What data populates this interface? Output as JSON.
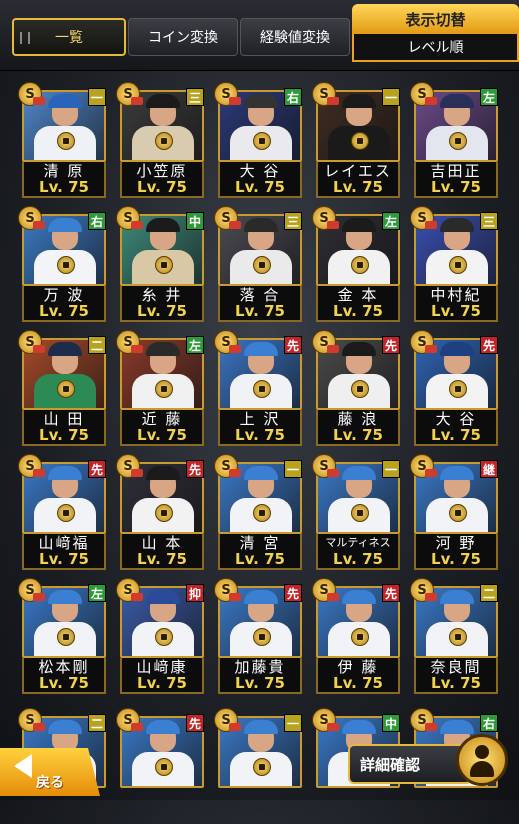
{
  "tabs": [
    {
      "label": "一覧",
      "active": true
    },
    {
      "label": "コイン変換",
      "active": false
    },
    {
      "label": "経験値変換",
      "active": false
    }
  ],
  "display_switch": {
    "title": "表示切替",
    "sort": "レベル順"
  },
  "level_prefix": "Lv.",
  "cards": [
    {
      "name": "清 原",
      "level": "75",
      "position": "一",
      "pos_color": "#b8a21e",
      "bg": "#4f86c9",
      "cap": "#2a63b8",
      "uniform": "#eef2f6"
    },
    {
      "name": "小笠原",
      "level": "75",
      "position": "三",
      "pos_color": "#b8a21e",
      "bg": "#3b3b3b",
      "cap": "#1b1b1b",
      "uniform": "#d9cbb0"
    },
    {
      "name": "大 谷",
      "level": "75",
      "position": "右",
      "pos_color": "#2f9a3a",
      "bg": "#2b3a7a",
      "cap": "#333",
      "uniform": "#e9e9ee"
    },
    {
      "name": "レイエス",
      "level": "75",
      "position": "一",
      "pos_color": "#b8a21e",
      "bg": "#3f2c22",
      "cap": "#1b1b1b",
      "uniform": "#1a1a1a"
    },
    {
      "name": "吉田正",
      "level": "75",
      "position": "左",
      "pos_color": "#2f9a3a",
      "bg": "#6b4a8a",
      "cap": "#2a2f5a",
      "uniform": "#e3e6ee"
    },
    {
      "name": "万 波",
      "level": "75",
      "position": "右",
      "pos_color": "#2f9a3a",
      "bg": "#3c7ac3",
      "cap": "#3a7fd1",
      "uniform": "#f2f4f7"
    },
    {
      "name": "糸 井",
      "level": "75",
      "position": "中",
      "pos_color": "#2f9a3a",
      "bg": "#3e8a7a",
      "cap": "#1b1b1b",
      "uniform": "#d9c8a6"
    },
    {
      "name": "落 合",
      "level": "75",
      "position": "三",
      "pos_color": "#b8a21e",
      "bg": "#4a4a52",
      "cap": "#2a2a2a",
      "uniform": "#eaeaea"
    },
    {
      "name": "金 本",
      "level": "75",
      "position": "左",
      "pos_color": "#2f9a3a",
      "bg": "#2e2e34",
      "cap": "#1b1b1b",
      "uniform": "#f1f1f1"
    },
    {
      "name": "中村紀",
      "level": "75",
      "position": "三",
      "pos_color": "#b8a21e",
      "bg": "#3a4fb0",
      "cap": "#2a2a2a",
      "uniform": "#f3f3f3"
    },
    {
      "name": "山 田",
      "level": "75",
      "position": "二",
      "pos_color": "#b8a21e",
      "bg": "#a54a2a",
      "cap": "#1b2d4a",
      "uniform": "#2c8a55"
    },
    {
      "name": "近 藤",
      "level": "75",
      "position": "左",
      "pos_color": "#2f9a3a",
      "bg": "#8a3a2a",
      "cap": "#2a2a2a",
      "uniform": "#f0f0f0"
    },
    {
      "name": "上 沢",
      "level": "75",
      "position": "先",
      "pos_color": "#c2242a",
      "bg": "#3b74c4",
      "cap": "#3a7fd1",
      "uniform": "#f0f2f6"
    },
    {
      "name": "藤 浪",
      "level": "75",
      "position": "先",
      "pos_color": "#c2242a",
      "bg": "#4a4a4a",
      "cap": "#1b1b1b",
      "uniform": "#efefef"
    },
    {
      "name": "大 谷",
      "level": "75",
      "position": "先",
      "pos_color": "#c2242a",
      "bg": "#2f64b4",
      "cap": "#1e3f80",
      "uniform": "#f3f3f3"
    },
    {
      "name": "山﨑福",
      "level": "75",
      "position": "先",
      "pos_color": "#c2242a",
      "bg": "#3a78c6",
      "cap": "#3a7fd1",
      "uniform": "#f1f3f7"
    },
    {
      "name": "山 本",
      "level": "75",
      "position": "先",
      "pos_color": "#c2242a",
      "bg": "#2f2f3a",
      "cap": "#1b1b1b",
      "uniform": "#f2f2f2"
    },
    {
      "name": "清 宮",
      "level": "75",
      "position": "一",
      "pos_color": "#b8a21e",
      "bg": "#3a78c6",
      "cap": "#3a7fd1",
      "uniform": "#f1f3f7"
    },
    {
      "name": "マルティネス",
      "level": "75",
      "position": "一",
      "pos_color": "#b8a21e",
      "bg": "#3a78c6",
      "cap": "#3a7fd1",
      "uniform": "#f1f3f7"
    },
    {
      "name": "河 野",
      "level": "75",
      "position": "継",
      "pos_color": "#c2242a",
      "bg": "#3a78c6",
      "cap": "#3a7fd1",
      "uniform": "#f1f3f7"
    },
    {
      "name": "松本剛",
      "level": "75",
      "position": "左",
      "pos_color": "#2f9a3a",
      "bg": "#3a78c6",
      "cap": "#3a7fd1",
      "uniform": "#f1f3f7"
    },
    {
      "name": "山﨑康",
      "level": "75",
      "position": "抑",
      "pos_color": "#c2242a",
      "bg": "#3b5aa8",
      "cap": "#2a4a9a",
      "uniform": "#f1f3f7"
    },
    {
      "name": "加藤貴",
      "level": "75",
      "position": "先",
      "pos_color": "#c2242a",
      "bg": "#3a78c6",
      "cap": "#3a7fd1",
      "uniform": "#f1f3f7"
    },
    {
      "name": "伊 藤",
      "level": "75",
      "position": "先",
      "pos_color": "#c2242a",
      "bg": "#3a78c6",
      "cap": "#3a7fd1",
      "uniform": "#f1f3f7"
    },
    {
      "name": "奈良間",
      "level": "75",
      "position": "二",
      "pos_color": "#b8a21e",
      "bg": "#3a78c6",
      "cap": "#3a7fd1",
      "uniform": "#f1f3f7"
    }
  ],
  "partial_row": [
    {
      "position": "二",
      "pos_color": "#b8a21e",
      "bg": "#3a78c6",
      "cap": "#3a7fd1",
      "uniform": "#f1f3f7"
    },
    {
      "position": "先",
      "pos_color": "#c2242a",
      "bg": "#3a78c6",
      "cap": "#3a7fd1",
      "uniform": "#f1f3f7"
    },
    {
      "position": "一",
      "pos_color": "#b8a21e",
      "bg": "#3a78c6",
      "cap": "#3a7fd1",
      "uniform": "#f1f3f7"
    },
    {
      "position": "中",
      "pos_color": "#2f9a3a",
      "bg": "#3a78c6",
      "cap": "#3a7fd1",
      "uniform": "#f1f3f7"
    },
    {
      "position": "右",
      "pos_color": "#2f9a3a",
      "bg": "#3a78c6",
      "cap": "#3a7fd1",
      "uniform": "#f1f3f7"
    }
  ],
  "back_button": {
    "label": "戻る"
  },
  "detail_button": {
    "label": "詳細確認"
  }
}
